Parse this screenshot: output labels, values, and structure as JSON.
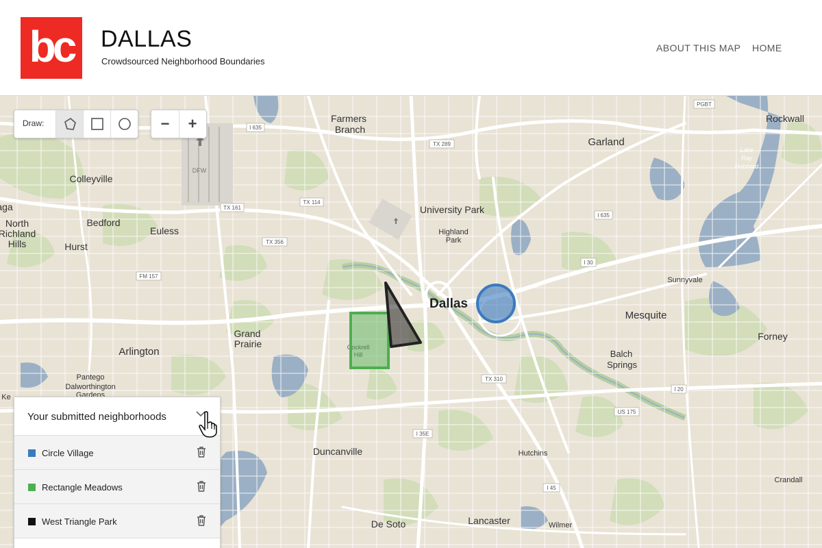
{
  "header": {
    "logo_text": "bc",
    "title": "DALLAS",
    "subtitle": "Crowdsourced Neighborhood Boundaries",
    "nav": [
      {
        "label": "ABOUT THIS MAP"
      },
      {
        "label": "HOME"
      }
    ]
  },
  "draw_control": {
    "label": "Draw:",
    "tools": [
      "polygon-icon",
      "rectangle-icon",
      "circle-icon"
    ],
    "active_tool": "polygon"
  },
  "zoom_control": {
    "zoom_out": "−",
    "zoom_in": "+"
  },
  "map": {
    "places": {
      "dallas": "Dallas",
      "farmers_branch_1": "Farmers",
      "farmers_branch_2": "Branch",
      "garland": "Garland",
      "rockwall": "Rockwall",
      "colleyville": "Colleyville",
      "north_richland_1": "North",
      "north_richland_2": "Richland",
      "north_richland_3": "Hills",
      "bedford": "Bedford",
      "euless": "Euless",
      "hurst": "Hurst",
      "university_park": "University Park",
      "highland_park_1": "Highland",
      "highland_park_2": "Park",
      "sunnyvale": "Sunnyvale",
      "mesquite": "Mesquite",
      "forney": "Forney",
      "grand_prairie_1": "Grand",
      "grand_prairie_2": "Prairie",
      "arlington": "Arlington",
      "pantego": "Pantego",
      "dalworthington_1": "Dalworthington",
      "dalworthington_2": "Gardens",
      "cockrell_hill_1": "Cockrell",
      "cockrell_hill_2": "Hill",
      "balch_springs_1": "Balch",
      "balch_springs_2": "Springs",
      "duncanville": "Duncanville",
      "hutchins": "Hutchins",
      "crandall": "Crandall",
      "de_soto": "De Soto",
      "lancaster": "Lancaster",
      "wilmer": "Wilmer",
      "lake_ray_hubbard_1": "Lake",
      "lake_ray_hubbard_2": "Ray",
      "lake_ray_hubbard_3": "Hubbard",
      "dfw": "DFW",
      "edge_aga": "aga",
      "edge_ke": "Ke"
    },
    "highways": {
      "i635_w": "I 635",
      "tx289": "TX 289",
      "pgbt": "PGBT",
      "tx161": "TX 161",
      "tx114": "TX 114",
      "i635_e": "I 635",
      "tx356": "TX 356",
      "i30": "I 30",
      "fm157": "FM 157",
      "tx310": "TX 310",
      "i20": "I 20",
      "us175": "US 175",
      "i35e": "I 35E",
      "i45": "I 45"
    },
    "shape_colors": {
      "circle": "#3a7abf",
      "rectangle": "#4caf50",
      "triangle": "#222222"
    }
  },
  "panel": {
    "title": "Your submitted neighborhoods",
    "items": [
      {
        "label": "Circle Village",
        "color": "#3a7abf"
      },
      {
        "label": "Rectangle Meadows",
        "color": "#4caf50"
      },
      {
        "label": "West Triangle Park",
        "color": "#111111"
      }
    ]
  }
}
